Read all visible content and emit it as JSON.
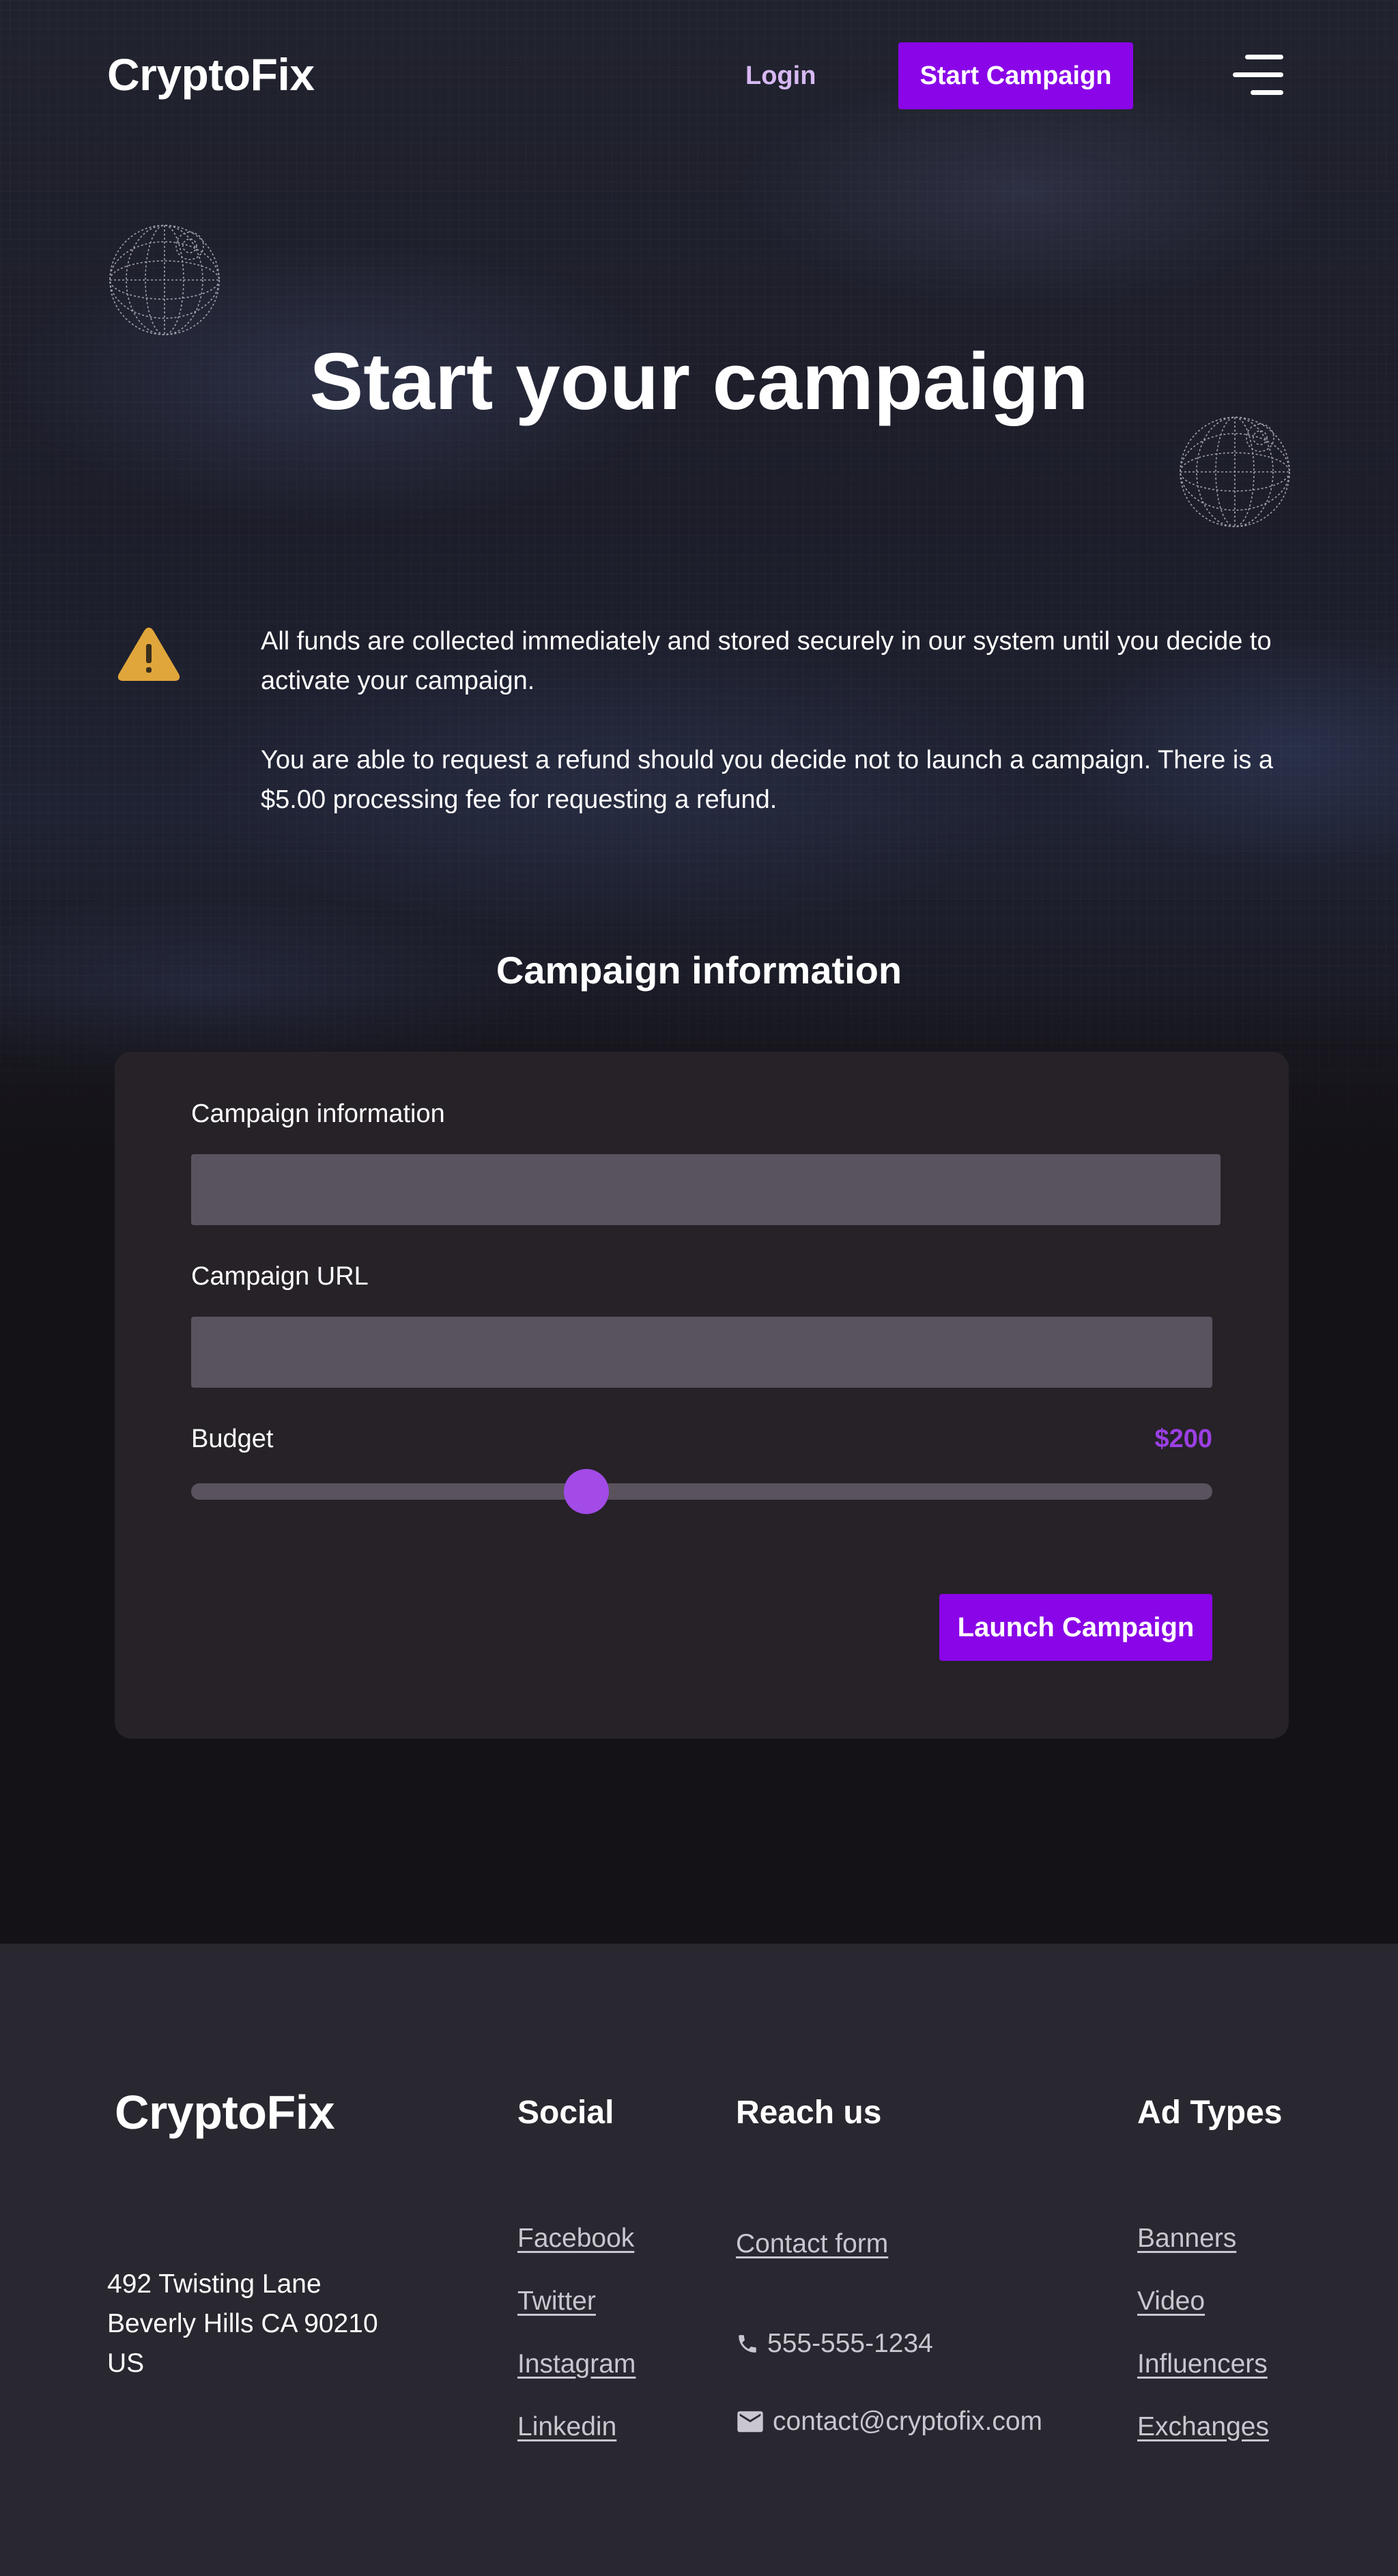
{
  "header": {
    "logo": "CryptoFix",
    "login_label": "Login",
    "start_campaign_label": "Start Campaign",
    "menu_icon": "menu-icon"
  },
  "hero": {
    "title": "Start your campaign",
    "decorations": [
      "globe-icon",
      "globe-icon"
    ]
  },
  "notice": {
    "icon": "warning-icon",
    "paragraphs": [
      "All funds are collected immediately and stored securely in our system until you decide to activate your campaign.",
      "You are able to request a refund should you decide not to launch a campaign. There is a $5.00 processing fee for requesting a refund."
    ]
  },
  "form": {
    "section_title": "Campaign information",
    "campaign_info_label": "Campaign information",
    "campaign_info_value": "",
    "campaign_url_label": "Campaign URL",
    "campaign_url_value": "",
    "budget_label": "Budget",
    "budget_value": "$200",
    "budget_fraction": 0.387,
    "launch_label": "Launch Campaign"
  },
  "footer": {
    "logo": "CryptoFix",
    "address": [
      "492 Twisting Lane",
      "Beverly Hills CA 90210",
      "US"
    ],
    "social": {
      "heading": "Social",
      "links": [
        "Facebook",
        "Twitter",
        "Instagram",
        "Linkedin"
      ]
    },
    "reach": {
      "heading": "Reach us",
      "contact_form": "Contact form",
      "phone": "555-555-1234",
      "phone_icon": "phone-icon",
      "email": "contact@cryptofix.com",
      "email_icon": "mail-icon"
    },
    "ad_types": {
      "heading": "Ad Types",
      "links": [
        "Banners",
        "Video",
        "Influencers",
        "Exchanges"
      ]
    }
  },
  "colors": {
    "accent": "#8a05e8",
    "accent_light": "#9b3fe3",
    "login_text": "#d6b8f2",
    "warning": "#e0a63b",
    "card_bg": "#262228",
    "input_bg": "#595360",
    "footer_bg": "#29272f"
  }
}
